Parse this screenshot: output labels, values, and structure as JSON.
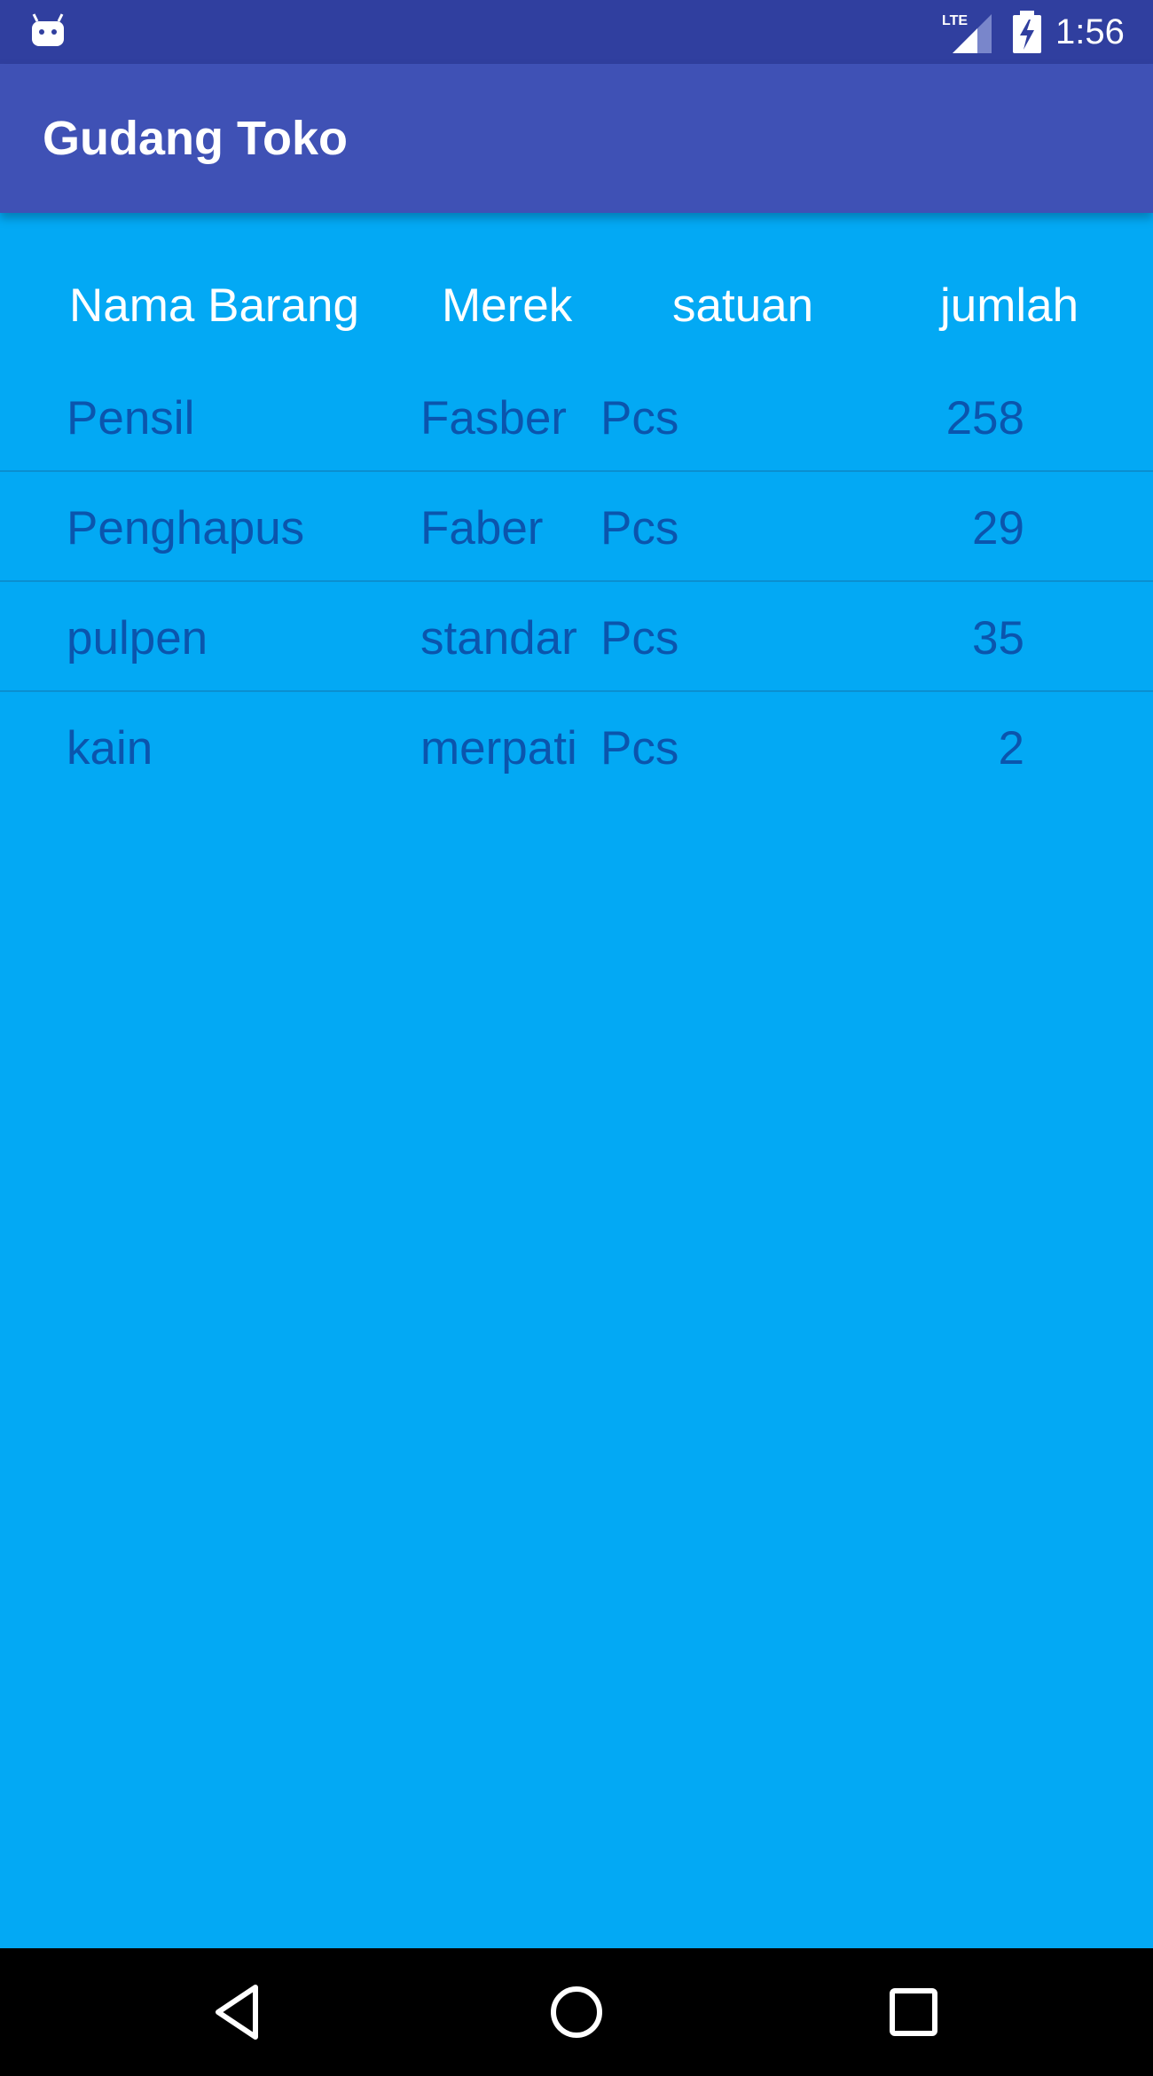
{
  "status_bar": {
    "time": "1:56",
    "network": "LTE",
    "icons": [
      "android-notification-icon",
      "lte-signal-icon",
      "battery-charging-icon"
    ]
  },
  "app_bar": {
    "title": "Gudang Toko"
  },
  "table": {
    "headers": {
      "nama": "Nama Barang",
      "merek": "Merek",
      "satuan": "satuan",
      "jumlah": "jumlah"
    },
    "rows": [
      {
        "nama": "Pensil",
        "merek": "Fasber",
        "satuan": "Pcs",
        "jumlah": "258"
      },
      {
        "nama": "Penghapus",
        "merek": "Faber",
        "satuan": "Pcs",
        "jumlah": "29"
      },
      {
        "nama": "pulpen",
        "merek": "standar",
        "satuan": "Pcs",
        "jumlah": "35"
      },
      {
        "nama": "kain",
        "merek": "merpati",
        "satuan": "Pcs",
        "jumlah": "2"
      }
    ]
  },
  "nav_bar": {
    "icons": [
      "back-icon",
      "home-icon",
      "recents-icon"
    ]
  },
  "colors": {
    "status_bar": "#303F9F",
    "app_bar": "#3F51B5",
    "background": "#03A9F4",
    "row_text": "#0D47A1"
  }
}
